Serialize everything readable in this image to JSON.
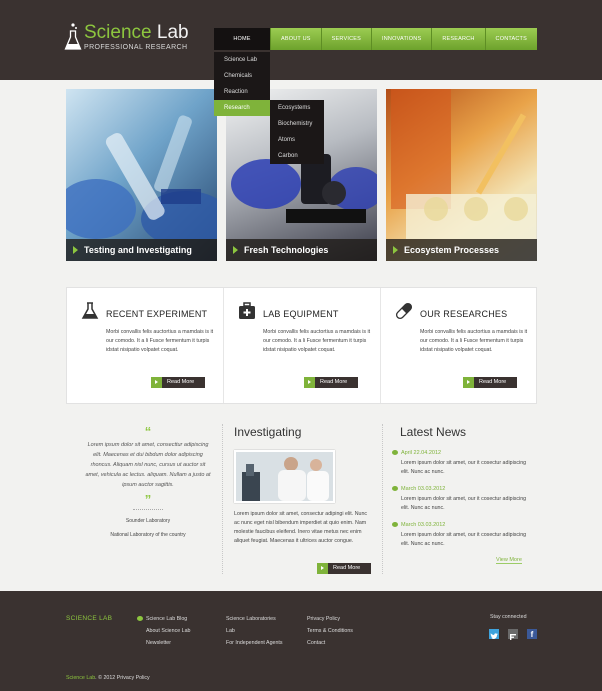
{
  "header": {
    "logo_word1": "Science",
    "logo_word2": "Lab",
    "logo_sub": "PROFESSIONAL RESEARCH"
  },
  "nav": {
    "items": [
      "HOME",
      "ABOUT US",
      "SERVICES",
      "INNOVATIONS",
      "RESEARCH",
      "CONTACTS"
    ],
    "active": "HOME"
  },
  "dropdown": {
    "items": [
      "Science Lab",
      "Chemicals",
      "Reaction",
      "Research"
    ],
    "selected": "Research",
    "sub_items": [
      "Ecosystems",
      "Biochemistry",
      "Atoms",
      "Carbon"
    ]
  },
  "slides": [
    {
      "caption": "Testing and Investigating"
    },
    {
      "caption": "Fresh Technologies"
    },
    {
      "caption": "Ecosystem Processes"
    }
  ],
  "features": [
    {
      "title": "RECENT EXPERIMENT",
      "icon": "flask-icon",
      "text": "Morbi convallis felis auctortius a mamdais is it our comodo. It a li Fusce fermentum it turpis idstat nisipatio volpatet coquat.",
      "button": "Read More"
    },
    {
      "title": "LAB EQUIPMENT",
      "icon": "first-aid-kit-icon",
      "text": "Morbi convallis felis auctortius a mamdais is it our comodo. It a li Fusce fermentum it turpis idstat nisipatio volpatet coquat.",
      "button": "Read More"
    },
    {
      "title": "OUR RESEARCHES",
      "icon": "capsule-icon",
      "text": "Morbi convallis felis auctortius a mamdais is it our comodo. It a li Fusce fermentum it turpis idstat nisipatio volpatet coquat.",
      "button": "Read More"
    }
  ],
  "quote": {
    "text": "Lorem ipsum dolor sit amet, consecttur adipiscing elit. Maecenas et dui bibdum dolor adipiscing rhoncus. Aliquam nisl nunc, cursus ut auctor sit amet, vehicula ac lectus. aliquam. Nullam a justo at ipsum auctor sagittis.",
    "author": "Sounder Laboratory",
    "organization": "National Laboratory of the country"
  },
  "investigating": {
    "title": "Investigating",
    "text": "Lorem ipsum dolor sit amet, consectur adipingi elit. Nunc ac nunc eget nisl bibendum imperdiet at quio enim. Nam molestie faucibus eleifend. Inero vitae metus nec enim aliquet feugiat. Maecenas it ultrices auctor congue.",
    "button": "Read More"
  },
  "news": {
    "title": "Latest News",
    "items": [
      {
        "date": "April 22.04.2012",
        "text": "Lorem ipsum dolor sit amet, our it cosectur adipiscing elit. Nunc ac nunc."
      },
      {
        "date": "March 03.03.2012",
        "text": "Lorem ipsum dolor sit amet, our it cosectur adipiscing elit. Nunc ac nunc."
      },
      {
        "date": "March 03.03.2012",
        "text": "Lorem ipsum dolor sit amet, our it cosectur adipiscing elit. Nunc ac nunc."
      }
    ],
    "view_more": "View More"
  },
  "footer": {
    "brand": "SCIENCE LAB",
    "col1": [
      "Science Lab Blog",
      "About Science Lab",
      "Newsletter"
    ],
    "col2": [
      "Science Laboratories",
      "Lab",
      "For Independent Agents"
    ],
    "col3": [
      "Privacy Policy",
      "Terms & Conditions",
      "Contact"
    ],
    "stay_connected": "Stay connected",
    "copyright_brand": "Science Lab",
    "copyright_rest": ". © 2012 Privacy Policy"
  },
  "colors": {
    "accent": "#8dc63f",
    "dark": "#3a3230"
  }
}
